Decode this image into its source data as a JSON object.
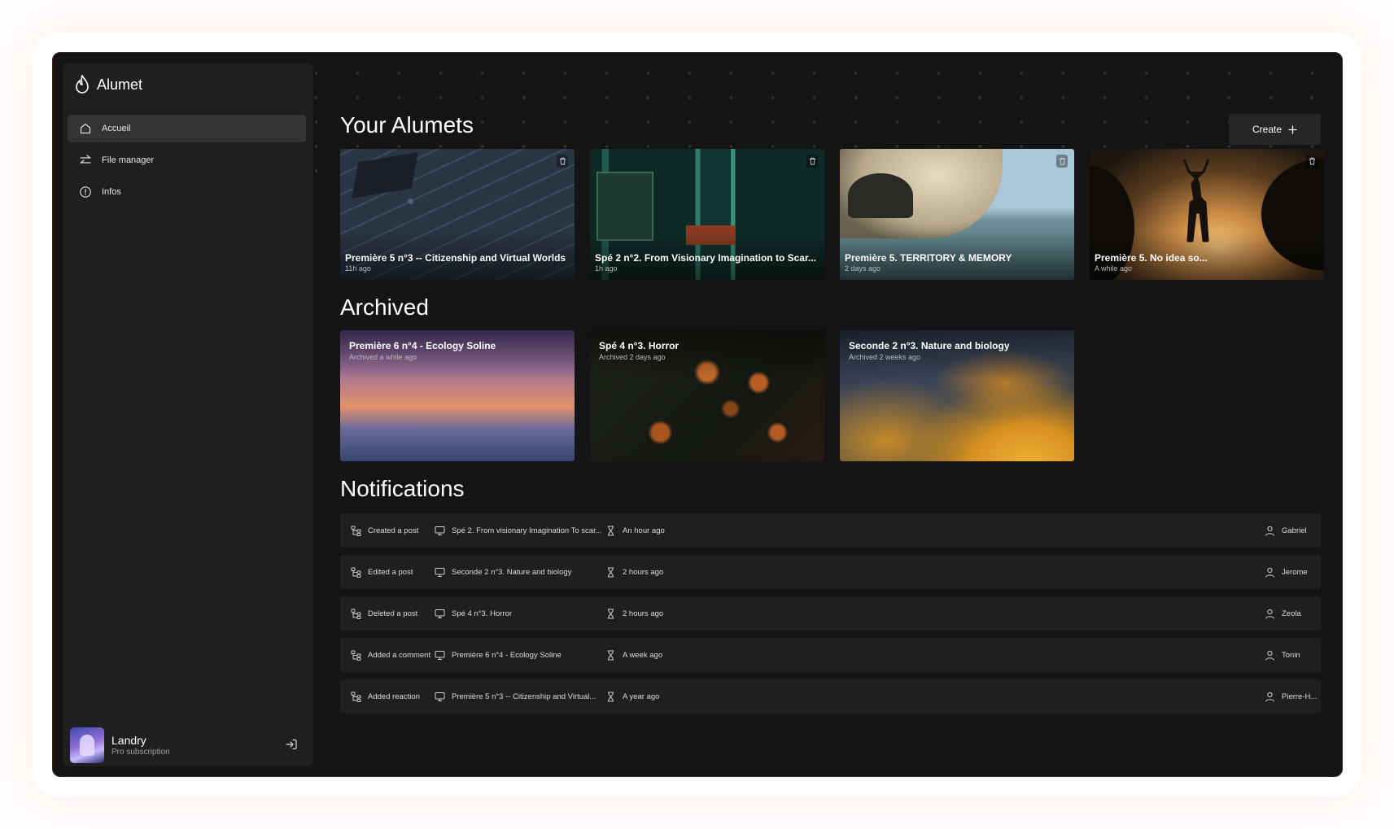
{
  "app": {
    "name": "Alumet"
  },
  "sidebar": {
    "items": [
      {
        "label": "Accueil",
        "icon": "home-icon",
        "active": true
      },
      {
        "label": "File manager",
        "icon": "swap-icon",
        "active": false
      },
      {
        "label": "Infos",
        "icon": "info-icon",
        "active": false
      }
    ],
    "user": {
      "name": "Landry",
      "subscription": "Pro subscription"
    }
  },
  "alumets": {
    "heading": "Your Alumets",
    "create_label": "Create",
    "cards": [
      {
        "title": "Première 5 n°3 -- Citizenship and Virtual Worlds",
        "time": "11h ago"
      },
      {
        "title": "Spé 2 n°2. From Visionary Imagination to Scar...",
        "time": "1h ago"
      },
      {
        "title": "Première 5. TERRITORY & MEMORY",
        "time": "2 days ago"
      },
      {
        "title": "Première 5. No idea so...",
        "time": "A while ago"
      }
    ]
  },
  "archived": {
    "heading": "Archived",
    "cards": [
      {
        "title": "Première 6 n°4 - Ecology Soline",
        "time": "Archived a while ago"
      },
      {
        "title": "Spé 4 n°3. Horror",
        "time": "Archived 2 days ago"
      },
      {
        "title": "Seconde 2 n°3. Nature and biology",
        "time": "Archived 2 weeks ago"
      }
    ]
  },
  "notifications": {
    "heading": "Notifications",
    "rows": [
      {
        "action": "Created a post",
        "target": "Spé 2. From visionary Imagination To scar...",
        "time": "An hour ago",
        "user": "Gabriel"
      },
      {
        "action": "Edited a post",
        "target": "Seconde 2 n°3. Nature and biology",
        "time": "2 hours ago",
        "user": "Jerome"
      },
      {
        "action": "Deleted a post",
        "target": "Spé 4 n°3. Horror",
        "time": "2 hours ago",
        "user": "Zeola"
      },
      {
        "action": "Added a comment",
        "target": "Première 6 n°4 - Ecology Soline",
        "time": "A week ago",
        "user": "Tonin"
      },
      {
        "action": "Added reaction",
        "target": "Première 5 n°3 -- Citizenship and Virtual...",
        "time": "A year ago",
        "user": "Pierre-H..."
      }
    ]
  },
  "colors": {
    "background": "#141414",
    "panel": "#1f1f1f",
    "active": "#343434",
    "text": "#ffffff",
    "accent_glow": "#ff8c6e"
  }
}
